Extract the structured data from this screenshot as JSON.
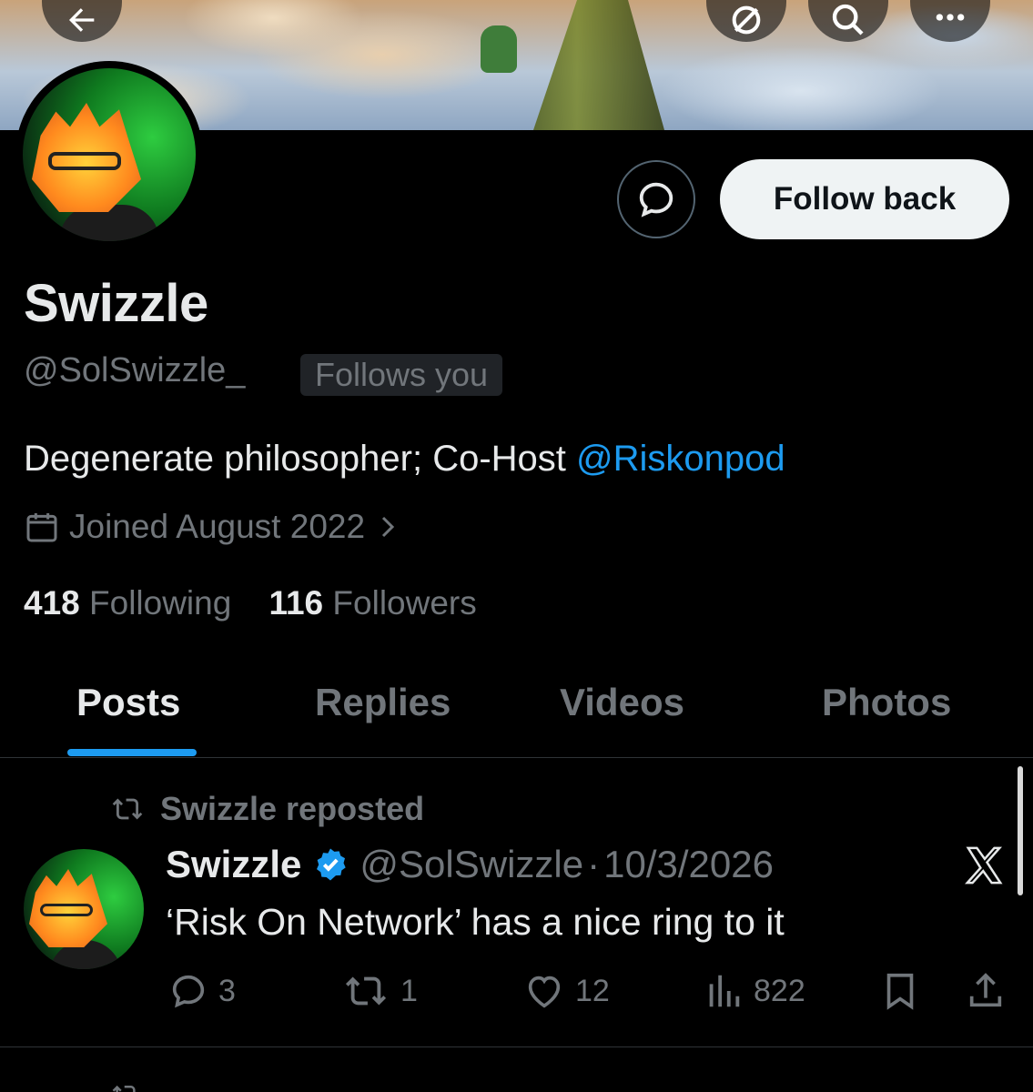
{
  "profile": {
    "display_name": "Swizzle",
    "handle": "@SolSwizzle_",
    "follows_you_badge": "Follows you",
    "bio_text": "Degenerate philosopher; Co-Host ",
    "bio_mention": "@Riskonpod",
    "joined": "Joined August 2022",
    "following_count": "418",
    "following_label": "Following",
    "followers_count": "116",
    "followers_label": "Followers",
    "follow_button": "Follow back"
  },
  "tabs": [
    {
      "label": "Posts",
      "active": true
    },
    {
      "label": "Replies",
      "active": false
    },
    {
      "label": "Videos",
      "active": false
    },
    {
      "label": "Photos",
      "active": false
    }
  ],
  "post": {
    "repost_label": "Swizzle reposted",
    "author_name": "Swizzle",
    "author_handle": "@SolSwizzle",
    "separator": "·",
    "date": "10/3/2026",
    "text": "‘Risk On Network’ has a nice ring to it",
    "reply_count": "3",
    "repost_count": "1",
    "like_count": "12",
    "view_count": "822"
  },
  "colors": {
    "accent": "#1d9bf0",
    "background": "#000000",
    "muted_text": "#71767b"
  },
  "icons": [
    "back-arrow-icon",
    "repost-icon",
    "search-icon",
    "more-icon",
    "message-icon",
    "calendar-icon",
    "chevron-right-icon",
    "verified-badge-icon",
    "x-logo-icon",
    "reply-icon",
    "like-icon",
    "views-icon",
    "bookmark-icon",
    "share-icon"
  ]
}
